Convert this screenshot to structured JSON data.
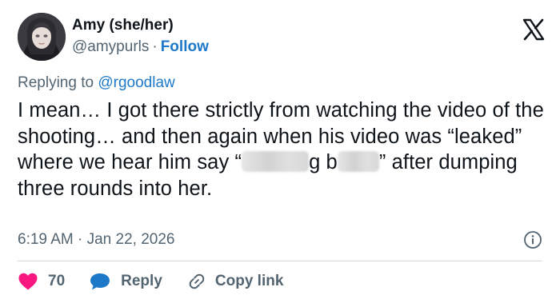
{
  "author": {
    "name": "Amy (she/her)",
    "handle": "@amypurls",
    "separator": "·",
    "follow_label": "Follow"
  },
  "reply_context": {
    "prefix": "Replying to ",
    "handle": "@rgoodlaw"
  },
  "tweet": {
    "part1": "I mean… I got there strictly from watching the video of the shooting… and then again when his video was “leaked” where we hear him say “",
    "part2": "g b",
    "part3": "” after dumping three rounds into her."
  },
  "meta": {
    "timestamp": "6:19 AM · Jan 22, 2026"
  },
  "actions": {
    "like_count": "70",
    "reply_label": "Reply",
    "copy_label": "Copy link"
  },
  "colors": {
    "text": "#0f1419",
    "secondary": "#536471",
    "link": "#1d79c8",
    "heart": "#f91880",
    "reply_icon": "#1d79c8",
    "divider": "#cfd9de"
  },
  "icons": {
    "logo": "x-logo-icon",
    "info": "info-icon",
    "like": "heart-icon",
    "reply": "speech-bubble-icon",
    "copy": "link-icon"
  }
}
